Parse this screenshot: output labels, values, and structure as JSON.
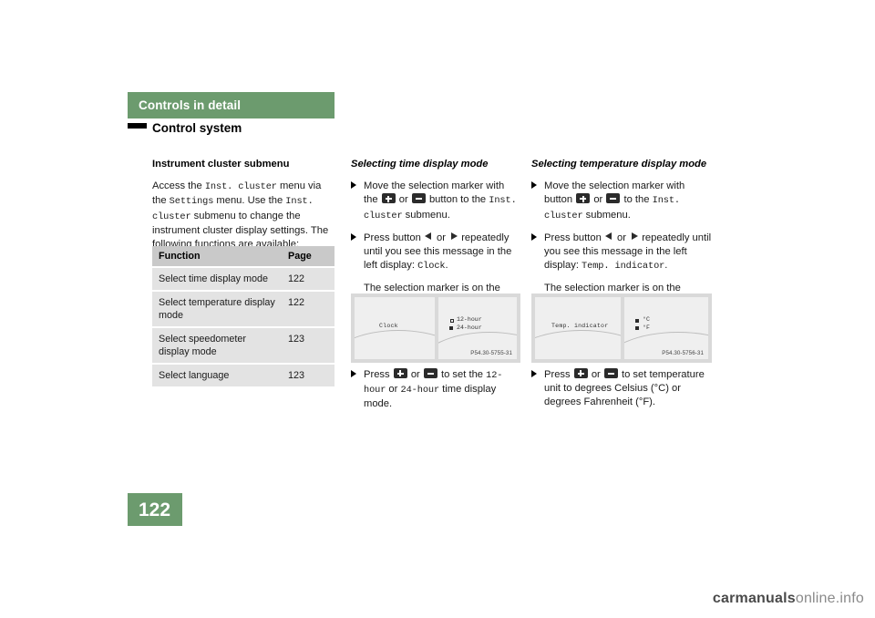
{
  "header": {
    "band_title": "Controls in detail",
    "section_title": "Control system",
    "band_color": "#6c9b6e"
  },
  "page_number": "122",
  "column1": {
    "title": "Instrument cluster submenu",
    "paragraph_parts": {
      "p1_a": "Access the ",
      "p1_mono1": "Inst. cluster",
      "p1_b": " menu via the ",
      "p1_mono2": "Settings",
      "p1_c": " menu. Use the ",
      "p1_mono3": "Inst. cluster",
      "p1_d": " submenu to change the instrument cluster display settings. The following functions are available:"
    },
    "table": {
      "headers": [
        "Function",
        "Page"
      ],
      "rows": [
        {
          "function": "Select time display mode",
          "page": "122"
        },
        {
          "function": "Select temperature display mode",
          "page": "122"
        },
        {
          "function": "Select speedometer display mode",
          "page": "123"
        },
        {
          "function": "Select language",
          "page": "123"
        }
      ]
    }
  },
  "column2": {
    "title": "Selecting time display mode",
    "bullet1": {
      "a": "Move the selection marker with the ",
      "b": " or ",
      "c": " button to the ",
      "mono": "Inst. cluster",
      "d": " submenu."
    },
    "bullet2": {
      "a": "Press button ",
      "b": " or ",
      "c": " repeatedly until you see this message in the left display: ",
      "mono": "Clock",
      "d": "."
    },
    "note": "The selection marker is on the current setting.",
    "figure": {
      "left_display_text": "Clock",
      "option1": "12-hour",
      "option2": "24-hour",
      "caption": "P54.30-5755-31"
    },
    "bullet3": {
      "a": "Press ",
      "b": " or ",
      "c": " to set the ",
      "mono1": "12-hour",
      "d": " or ",
      "mono2": "24-hour",
      "e": " time display mode."
    }
  },
  "column3": {
    "title": "Selecting temperature display mode",
    "bullet1": {
      "a": "Move the selection marker with button ",
      "b": " or ",
      "c": " to the ",
      "mono": "Inst. cluster",
      "d": " submenu."
    },
    "bullet2": {
      "a": "Press button ",
      "b": " or ",
      "c": " repeatedly until you see this message in the left display: ",
      "mono": "Temp. indicator",
      "d": "."
    },
    "note": "The selection marker is on the current setting.",
    "figure": {
      "left_display_text": "Temp. indicator",
      "option1": "°C",
      "option2": "°F",
      "caption": "P54.30-5756-31"
    },
    "bullet3": {
      "a": "Press ",
      "b": " or ",
      "c": " to set temperature unit to degrees Celsius (",
      "unit1": "°C",
      "d": ") or degrees Fahrenheit (",
      "unit2": "°F",
      "e": ")."
    }
  },
  "watermark": {
    "bold": "carmanuals",
    "rest": "online.info"
  }
}
